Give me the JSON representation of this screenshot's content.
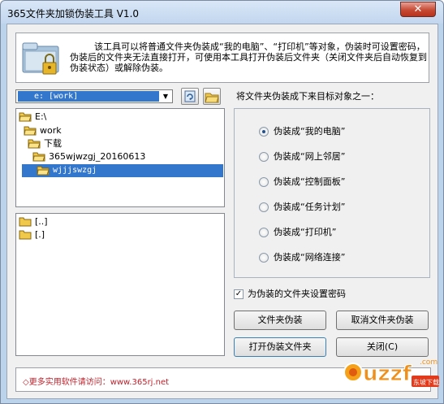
{
  "window": {
    "title": "365文件夹加锁伪装工具 V1.0",
    "close_glyph": "✕"
  },
  "banner": {
    "text": "该工具可以将普通文件夹伪装成“我的电脑”、“打印机”等对象，伪装时可设置密码，伪装后的文件夹无法直接打开，可使用本工具打开伪装后文件夹（关闭文件夹后自动恢复到伪装状态）或解除伪装。"
  },
  "drive": {
    "selected": "e: [work]",
    "arrow": "▼"
  },
  "folder_tree": [
    {
      "label": "E:\\",
      "selected": false
    },
    {
      "label": "work",
      "selected": false
    },
    {
      "label": "下载",
      "selected": false
    },
    {
      "label": "365wjwzgj_20160613",
      "selected": false
    },
    {
      "label": "wjjjswzgj",
      "selected": true
    }
  ],
  "file_list": [
    {
      "label": "[..]"
    },
    {
      "label": "[.]"
    }
  ],
  "target_label": "将文件夹伪装成下来目标对象之一：",
  "options": [
    {
      "label": "伪装成“我的电脑”",
      "checked": true
    },
    {
      "label": "伪装成“网上邻居”",
      "checked": false
    },
    {
      "label": "伪装成“控制面板”",
      "checked": false
    },
    {
      "label": "伪装成“任务计划”",
      "checked": false
    },
    {
      "label": "伪装成“打印机”",
      "checked": false
    },
    {
      "label": "伪装成“网络连接”",
      "checked": false
    }
  ],
  "password_checkbox": {
    "label": "为伪装的文件夹设置密码",
    "checked": true,
    "mark": "✓"
  },
  "buttons": {
    "disguise": "文件夹伪装",
    "undisguise": "取消文件夹伪装",
    "open": "打开伪装文件夹",
    "close": "关闭(C)"
  },
  "footer": {
    "text": "◇更多实用软件请访问：www.365rj.net"
  },
  "watermark": {
    "brand": "uzzf",
    "sub": "东坡下载",
    "domain": ".com"
  },
  "colors": {
    "selection": "#3377cc",
    "footer_text": "#c0202a",
    "title_bg": "#c2d6ee"
  }
}
